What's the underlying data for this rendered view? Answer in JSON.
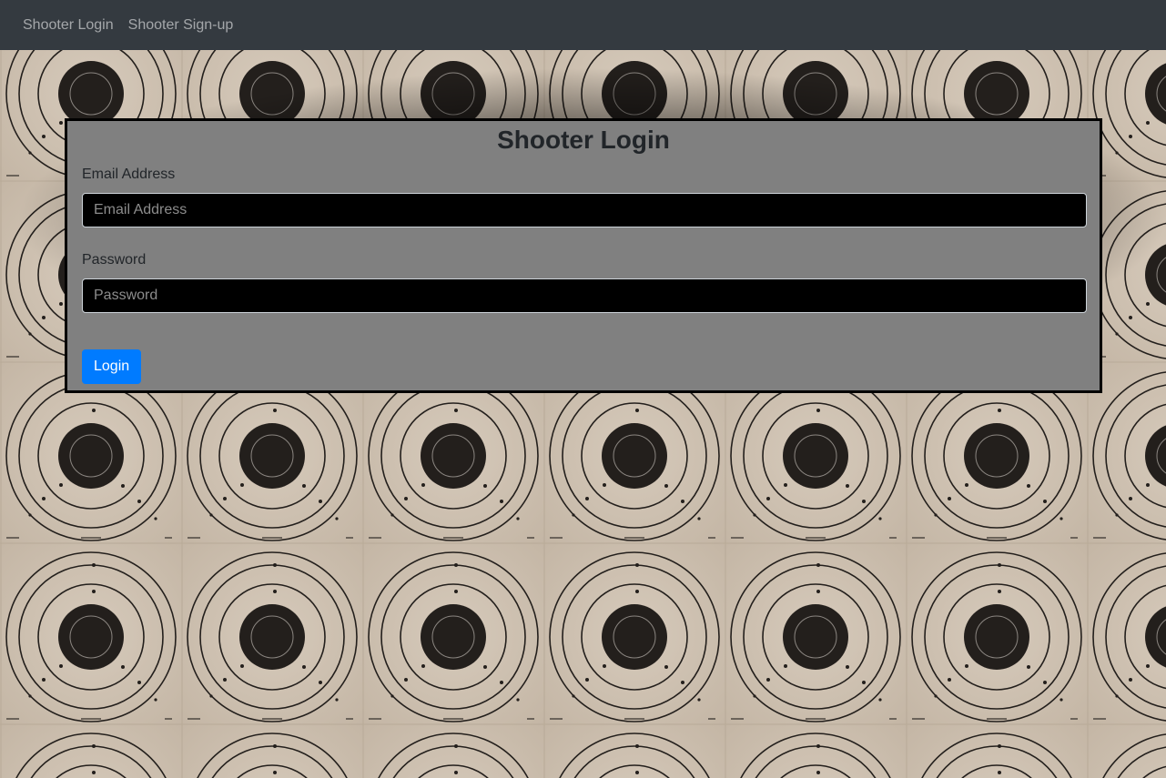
{
  "navbar": {
    "links": [
      {
        "label": "Shooter Login"
      },
      {
        "label": "Shooter Sign-up"
      }
    ],
    "background": "#343a40"
  },
  "login_form": {
    "title": "Shooter Login",
    "email_label": "Email Address",
    "email_placeholder": "Email Address",
    "email_value": "",
    "password_label": "Password",
    "password_placeholder": "Password",
    "password_value": "",
    "submit_label": "Login",
    "button_color": "#007bff",
    "card_color": "#808080"
  },
  "background": {
    "pattern": "shooting-target-icon",
    "paper_color": "#cfc2b2",
    "ring_color": "#231f1c"
  }
}
